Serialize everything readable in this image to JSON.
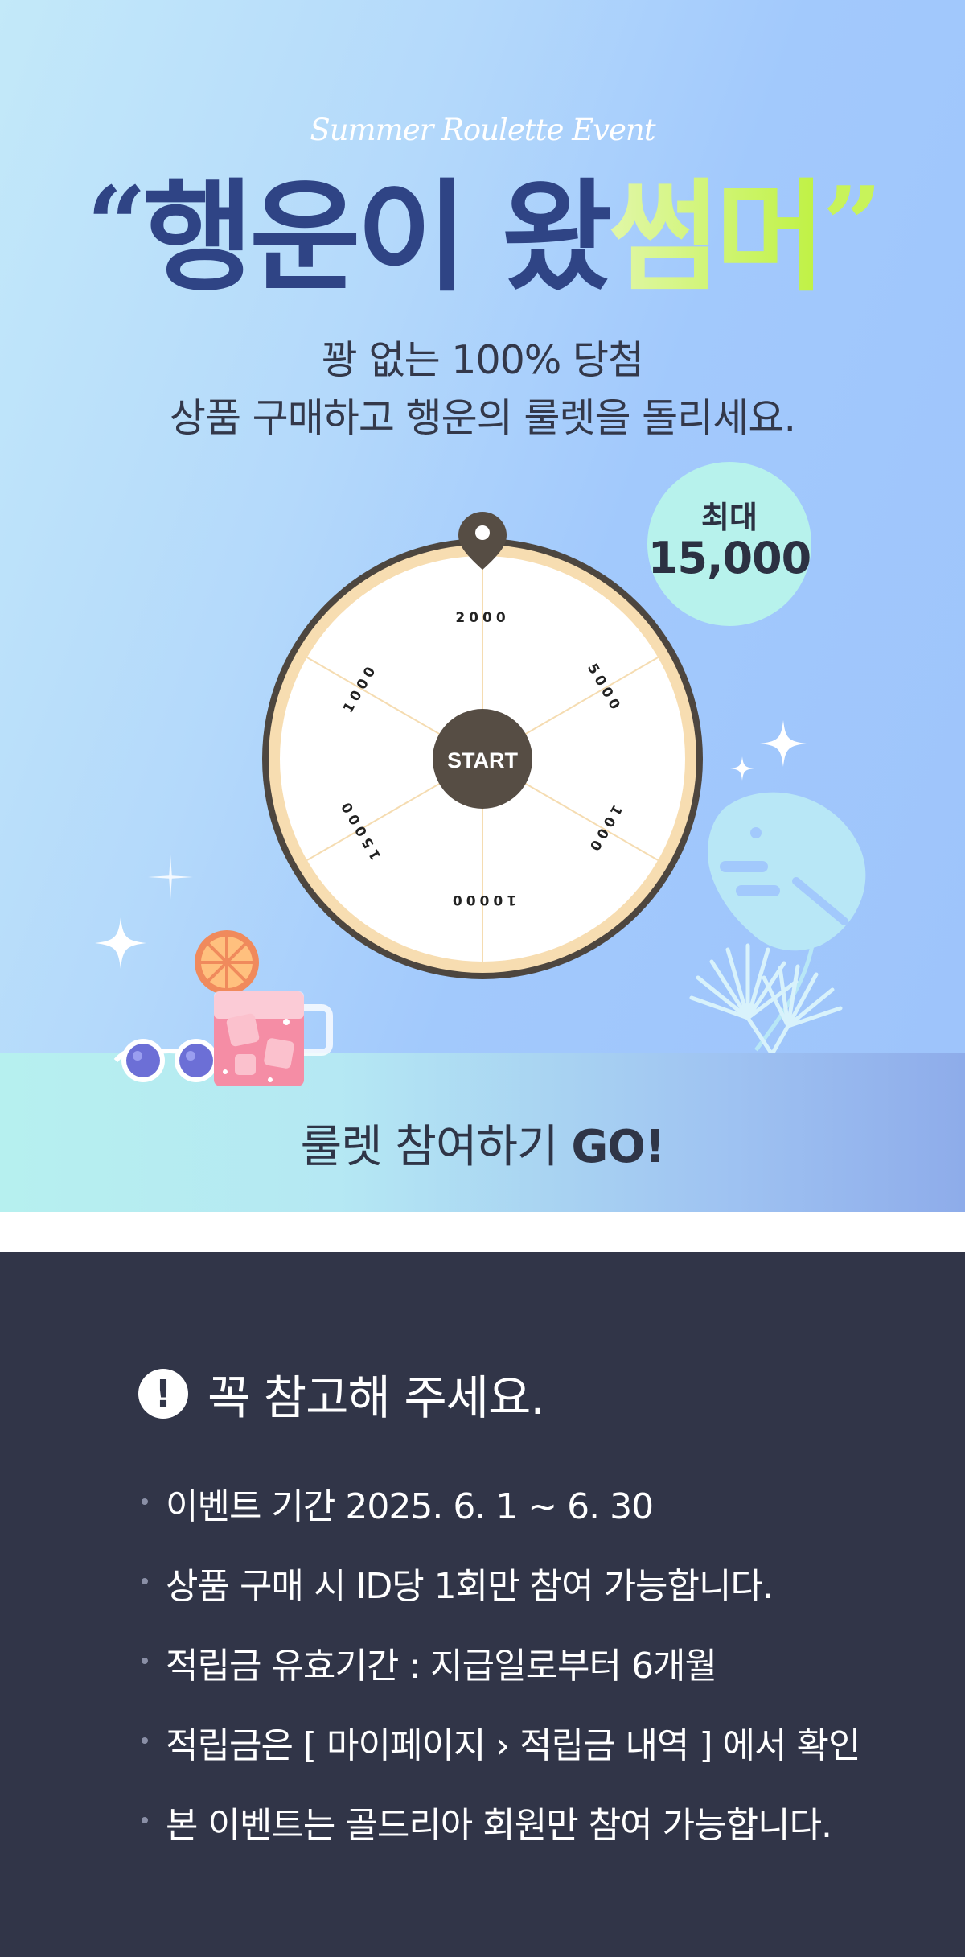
{
  "hero": {
    "eyebrow": "Summer Roulette Event",
    "headline_open_quote": "“",
    "headline_main": "행운이 왔",
    "headline_accent": "썸머",
    "headline_close_quote": "”",
    "subtitle_line1": "꽝 없는 100% 당첨",
    "subtitle_line2": "상품 구매하고 행운의 룰렛을 돌리세요.",
    "max_badge": {
      "label": "최대",
      "amount": "15,000"
    }
  },
  "roulette": {
    "center_label": "START",
    "segments": [
      "1000",
      "2000",
      "5000",
      "1000",
      "10000",
      "15000"
    ]
  },
  "cta": {
    "text": "룰렛 참여하기 ",
    "bold": "GO!"
  },
  "notice": {
    "title": "꼭 참고해 주세요.",
    "icon_glyph": "!",
    "items": [
      "이벤트 기간 2025. 6. 1 ~ 6. 30",
      "상품 구매 시 ID당 1회만 참여 가능합니다.",
      "적립금 유효기간 : 지급일로부터 6개월",
      "적립금은 [ 마이페이지 › 적립금 내역 ] 에서 확인",
      "본 이벤트는 골드리아 회원만 참여 가능합니다."
    ]
  },
  "colors": {
    "navy": "#2f4485",
    "lime": "#c8f35a",
    "notice_bg": "#313548",
    "wheel_rim": "#4d463f",
    "wheel_inner_rim": "#f7ddb1"
  }
}
